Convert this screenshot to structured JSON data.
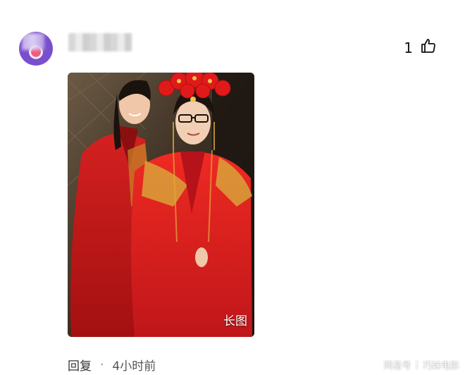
{
  "comment": {
    "likes_count": "1",
    "image_tag": "长图",
    "reply_label": "回复",
    "separator": "·",
    "time_ago": "4小时前"
  },
  "watermark": {
    "left": "网易号",
    "separator": "|",
    "right": "巧妹电影"
  }
}
